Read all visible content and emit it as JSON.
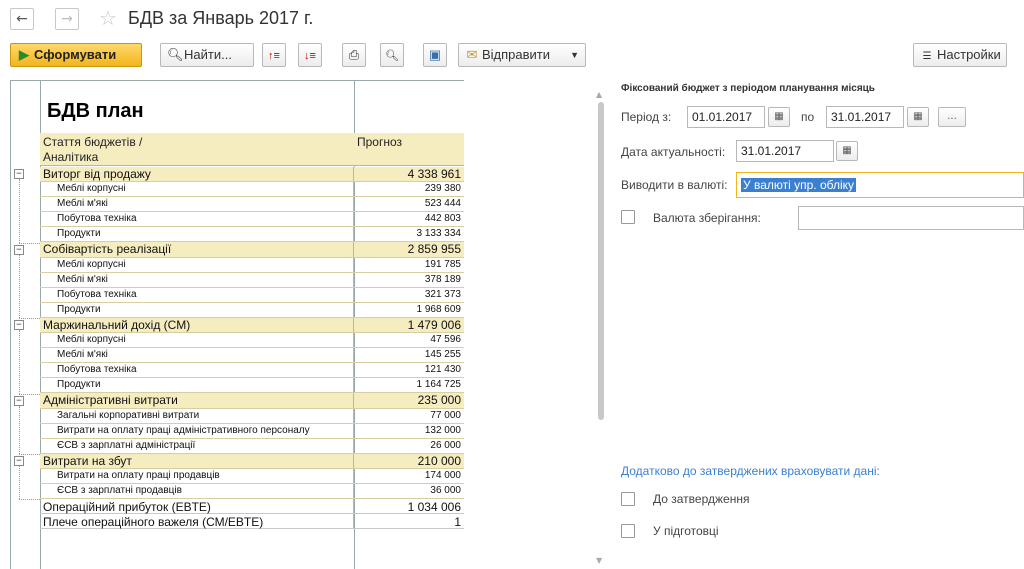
{
  "window": {
    "title": "БДВ  за Январь 2017 г.",
    "back_label": "←",
    "forward_label": "→",
    "star_glyph": "☆"
  },
  "toolbar": {
    "generate_label": "Сформувати",
    "find_label": "Найти...",
    "send_label": "Відправити",
    "settings_label": "Настройки"
  },
  "report": {
    "title": "БДВ план",
    "col_article": "Стаття бюджетів /",
    "col_analytics": "Аналітика",
    "col_forecast": "Прогноз",
    "rows": [
      {
        "label": "Виторг від продажу",
        "value": "4 338 961",
        "type": "group"
      },
      {
        "label": "Меблі корпусні",
        "value": "239 380",
        "type": "child"
      },
      {
        "label": "Меблі м'які",
        "value": "523 444",
        "type": "child"
      },
      {
        "label": "Побутова техніка",
        "value": "442 803",
        "type": "child"
      },
      {
        "label": "Продукти",
        "value": "3 133 334",
        "type": "child"
      },
      {
        "label": "Собівартість реалізації",
        "value": "2 859 955",
        "type": "group"
      },
      {
        "label": "Меблі корпусні",
        "value": "191 785",
        "type": "child"
      },
      {
        "label": "Меблі м'які",
        "value": "378 189",
        "type": "child"
      },
      {
        "label": "Побутова техніка",
        "value": "321 373",
        "type": "child"
      },
      {
        "label": "Продукти",
        "value": "1 968 609",
        "type": "child"
      },
      {
        "label": "Маржинальний дохід (СМ)",
        "value": "1 479 006",
        "type": "group"
      },
      {
        "label": "Меблі корпусні",
        "value": "47 596",
        "type": "child"
      },
      {
        "label": "Меблі м'які",
        "value": "145 255",
        "type": "child"
      },
      {
        "label": "Побутова техніка",
        "value": "121 430",
        "type": "child"
      },
      {
        "label": "Продукти",
        "value": "1 164 725",
        "type": "child"
      },
      {
        "label": "Адміністративні витрати",
        "value": "235 000",
        "type": "group"
      },
      {
        "label": "Загальні корпоративні витрати",
        "value": "77 000",
        "type": "child"
      },
      {
        "label": "Витрати на оплату праці адміністративного персоналу",
        "value": "132 000",
        "type": "child"
      },
      {
        "label": "ЄСВ з зарплатні адміністрації",
        "value": "26 000",
        "type": "child"
      },
      {
        "label": "Витрати на збут",
        "value": "210 000",
        "type": "group"
      },
      {
        "label": "Витрати на оплату праці продавців",
        "value": "174 000",
        "type": "child"
      },
      {
        "label": "ЄСВ з зарплатні продавців",
        "value": "36 000",
        "type": "child"
      },
      {
        "label": "Операційний прибуток (EBTE)",
        "value": "1 034 006",
        "type": "total"
      },
      {
        "label": "Плече операційного важеля (СМ/EBTE)",
        "value": "1",
        "type": "total"
      }
    ]
  },
  "panel": {
    "heading": "Фіксований бюджет з періодом планування місяць",
    "period_from_label": "Період з:",
    "period_from": "01.01.2017",
    "period_to_label": "по",
    "period_to": "31.01.2017",
    "more_label": "...",
    "actuality_label": "Дата актуальності:",
    "actuality_date": "31.01.2017",
    "currency_label": "Виводити в валюті:",
    "currency_value": "У валюті упр. обліку",
    "storage_currency_label": "Валюта зберігання:",
    "storage_currency_value": "",
    "extra_heading": "Додатково до затверджених враховувати дані:",
    "for_approval_label": "До затвердження",
    "in_preparation_label": "У підготовці"
  },
  "colors": {
    "accent_yellow": "#f2b51d",
    "header_fill": "#f5ecc0",
    "link_blue": "#3b7fd0"
  }
}
